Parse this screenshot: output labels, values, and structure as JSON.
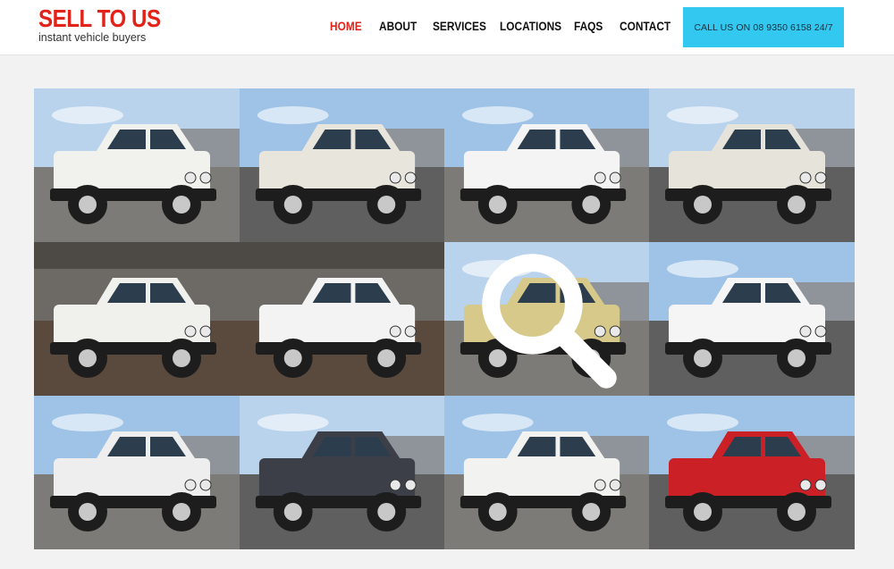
{
  "header": {
    "logo_title": "SELL TO US",
    "logo_tagline": "instant vehicle buyers",
    "nav": [
      {
        "label": "HOME",
        "active": true
      },
      {
        "label": "ABOUT",
        "active": false
      },
      {
        "label": "SERVICES",
        "active": false
      },
      {
        "label": "LOCATIONS",
        "active": false
      },
      {
        "label": "FAQS",
        "active": false
      },
      {
        "label": "CONTACT",
        "active": false
      }
    ],
    "cta_label": "CALL US ON 08 9350 6158 24/7"
  },
  "gallery": {
    "tiles": [
      {
        "vehicle": "white single cab ute with tray",
        "scene": "outdoor",
        "body": "#f1f1ee"
      },
      {
        "vehicle": "damaged white single cab ute with tray",
        "scene": "outdoor",
        "body": "#e7e5dc"
      },
      {
        "vehicle": "white 4WD wagon",
        "scene": "outdoor",
        "body": "#f4f4f4"
      },
      {
        "vehicle": "white single cab ute with tray",
        "scene": "outdoor",
        "body": "#e5e3da"
      },
      {
        "vehicle": "white dual cab ute",
        "scene": "indoor",
        "body": "#f0f0ec"
      },
      {
        "vehicle": "white dual cab ute with yellow stripe",
        "scene": "indoor",
        "body": "#f3f3f3"
      },
      {
        "vehicle": "sand single cab ute with tray",
        "scene": "outdoor",
        "body": "#d7c98a",
        "hover_zoom": true
      },
      {
        "vehicle": "white troop carrier",
        "scene": "outdoor",
        "body": "#f5f5f5"
      },
      {
        "vehicle": "damaged white dual cab ute",
        "scene": "outdoor",
        "body": "#eeeeee"
      },
      {
        "vehicle": "dark grey dual cab ute",
        "scene": "outdoor",
        "body": "#3c3f48"
      },
      {
        "vehicle": "white single cab ute",
        "scene": "outdoor",
        "body": "#f2f2f0"
      },
      {
        "vehicle": "red dual cab ute",
        "scene": "outdoor",
        "body": "#cc2027"
      }
    ]
  },
  "icons": {
    "zoom": "magnifier-icon"
  }
}
